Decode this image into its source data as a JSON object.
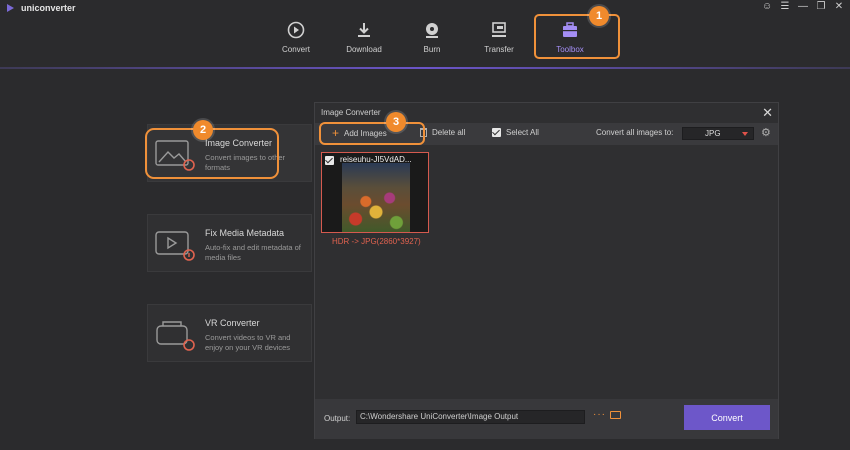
{
  "app": {
    "title": "uniconverter"
  },
  "window_controls": [
    "user-icon",
    "menu-icon",
    "minimize-icon",
    "restore-icon",
    "close-icon"
  ],
  "nav": {
    "items": [
      {
        "label": "Convert",
        "icon": "convert-icon"
      },
      {
        "label": "Download",
        "icon": "download-icon"
      },
      {
        "label": "Burn",
        "icon": "burn-icon"
      },
      {
        "label": "Transfer",
        "icon": "transfer-icon"
      },
      {
        "label": "Toolbox",
        "icon": "toolbox-icon",
        "active": true
      }
    ]
  },
  "badges": {
    "one": "1",
    "two": "2",
    "three": "3"
  },
  "tools": [
    {
      "name": "Image Converter",
      "desc": "Convert images to other formats"
    },
    {
      "name": "Fix Media Metadata",
      "desc": "Auto-fix and edit metadata of media files"
    },
    {
      "name": "VR Converter",
      "desc": "Convert videos to VR and enjoy on your VR devices"
    }
  ],
  "panel": {
    "title": "Image Converter",
    "add_images": "Add Images",
    "delete_all": "Delete all",
    "select_all": "Select All",
    "convert_all_label": "Convert all images to:",
    "format": "JPG",
    "image": {
      "name": "reiseuhu-JI5VdAD...",
      "info": "HDR -> JPG(2860*3927)"
    },
    "output_label": "Output:",
    "output_path": "C:\\Wondershare UniConverter\\Image Output",
    "convert_button": "Convert"
  },
  "colors": {
    "accent": "#6d57c9",
    "highlight": "#f0913a",
    "background": "#2b2b2d"
  }
}
